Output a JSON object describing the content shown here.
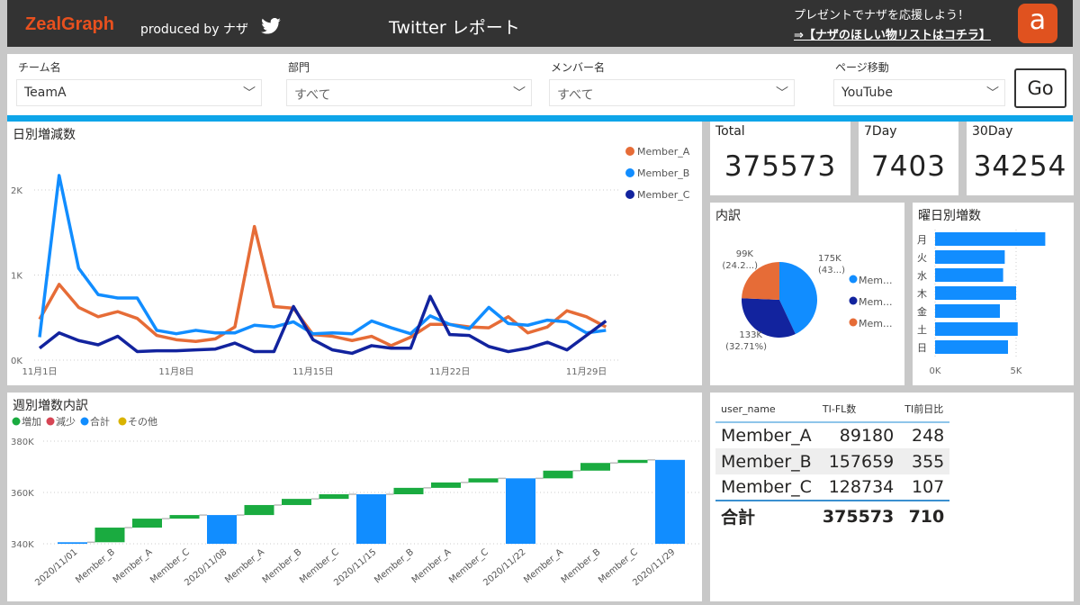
{
  "header": {
    "logo": "ZealGraph",
    "produced_by": "produced by ナザ",
    "title": "Twitter レポート",
    "promo_text": "プレゼントでナザを応援しよう！",
    "promo_link": "⇒【ナザのほしい物リストはコチラ】",
    "amazon_glyph": "a"
  },
  "filters": {
    "team": {
      "label": "チーム名",
      "value": "TeamA"
    },
    "dept": {
      "label": "部門",
      "value": "すべて"
    },
    "member": {
      "label": "メンバー名",
      "value": "すべて"
    },
    "page": {
      "label": "ページ移動",
      "value": "YouTube"
    },
    "go_label": "Go"
  },
  "cards": {
    "total": {
      "label": "Total",
      "value": "375573"
    },
    "d7": {
      "label": "7Day",
      "value": "7403"
    },
    "d30": {
      "label": "30Day",
      "value": "34254"
    }
  },
  "colors": {
    "member_a": "#e66c37",
    "member_b": "#118dff",
    "member_c": "#12239e",
    "increase": "#1aab40",
    "decrease": "#d64554",
    "total": "#118dff",
    "other": "#d9b300"
  },
  "table": {
    "headers": [
      "user_name",
      "TI-FL数",
      "TI前日比"
    ],
    "rows": [
      [
        "Member_A",
        "89180",
        "248"
      ],
      [
        "Member_B",
        "157659",
        "355"
      ],
      [
        "Member_C",
        "128734",
        "107"
      ]
    ],
    "total": [
      "合計",
      "375573",
      "710"
    ]
  },
  "chart_data": [
    {
      "type": "line",
      "title": "日別増減数",
      "ylim": [
        0,
        2400
      ],
      "yticks": [
        "0K",
        "1K",
        "2K"
      ],
      "ytick_values": [
        0,
        1000,
        2000
      ],
      "xtick_labels": [
        "11月1日",
        "11月8日",
        "11月15日",
        "11月22日",
        "11月29日"
      ],
      "xtick_index": [
        0,
        7,
        14,
        21,
        28
      ],
      "legend": "top-right",
      "series": [
        {
          "name": "Member_A",
          "values": [
            480,
            890,
            620,
            510,
            570,
            490,
            290,
            240,
            220,
            250,
            390,
            1570,
            630,
            610,
            300,
            280,
            230,
            280,
            170,
            270,
            420,
            420,
            390,
            380,
            510,
            320,
            390,
            580,
            510,
            390
          ]
        },
        {
          "name": "Member_B",
          "values": [
            270,
            2170,
            1080,
            770,
            730,
            730,
            350,
            310,
            350,
            320,
            320,
            410,
            390,
            450,
            310,
            320,
            310,
            460,
            380,
            310,
            520,
            420,
            370,
            620,
            430,
            410,
            470,
            450,
            320,
            350
          ]
        },
        {
          "name": "Member_C",
          "values": [
            140,
            320,
            230,
            180,
            280,
            100,
            110,
            110,
            120,
            130,
            200,
            100,
            100,
            630,
            240,
            120,
            80,
            170,
            140,
            140,
            750,
            300,
            290,
            160,
            100,
            140,
            210,
            120,
            290,
            460
          ]
        }
      ]
    },
    {
      "type": "pie",
      "title": "内訳",
      "slices": [
        {
          "name": "Member_B",
          "legend": "Mem...",
          "label": "175K",
          "pct": "(43...)",
          "value": 175
        },
        {
          "name": "Member_C",
          "legend": "Mem...",
          "label": "133K",
          "pct": "(32.71%)",
          "value": 133
        },
        {
          "name": "Member_A",
          "legend": "Mem...",
          "label": "99K",
          "pct": "(24.2...)",
          "value": 99
        }
      ]
    },
    {
      "type": "bar",
      "title": "曜日別増数",
      "categories": [
        "月",
        "火",
        "水",
        "木",
        "金",
        "土",
        "日"
      ],
      "values": [
        6800,
        4300,
        4200,
        5000,
        4000,
        5100,
        4500
      ],
      "xticks": [
        "0K",
        "5K"
      ],
      "xlim": [
        0,
        5000
      ]
    },
    {
      "type": "waterfall",
      "title": "週別増数内訳",
      "legend": [
        "増加",
        "減少",
        "合計",
        "その他"
      ],
      "ylim": [
        340000,
        380000
      ],
      "yticks": [
        "340K",
        "360K",
        "380K"
      ],
      "categories": [
        "2020/11/01",
        "Member_B",
        "Member_A",
        "Member_C",
        "2020/11/08",
        "Member_A",
        "Member_B",
        "Member_C",
        "2020/11/15",
        "Member_B",
        "Member_A",
        "Member_C",
        "2020/11/22",
        "Member_A",
        "Member_B",
        "Member_C",
        "2020/11/29"
      ],
      "kinds": [
        "total",
        "inc",
        "inc",
        "inc",
        "total",
        "inc",
        "inc",
        "inc",
        "total",
        "inc",
        "inc",
        "inc",
        "total",
        "inc",
        "inc",
        "inc",
        "total"
      ],
      "values": [
        340600,
        5700,
        3500,
        1400,
        351200,
        3900,
        2400,
        1800,
        359300,
        2500,
        2100,
        1600,
        365500,
        3000,
        3000,
        1200,
        372700
      ]
    }
  ]
}
